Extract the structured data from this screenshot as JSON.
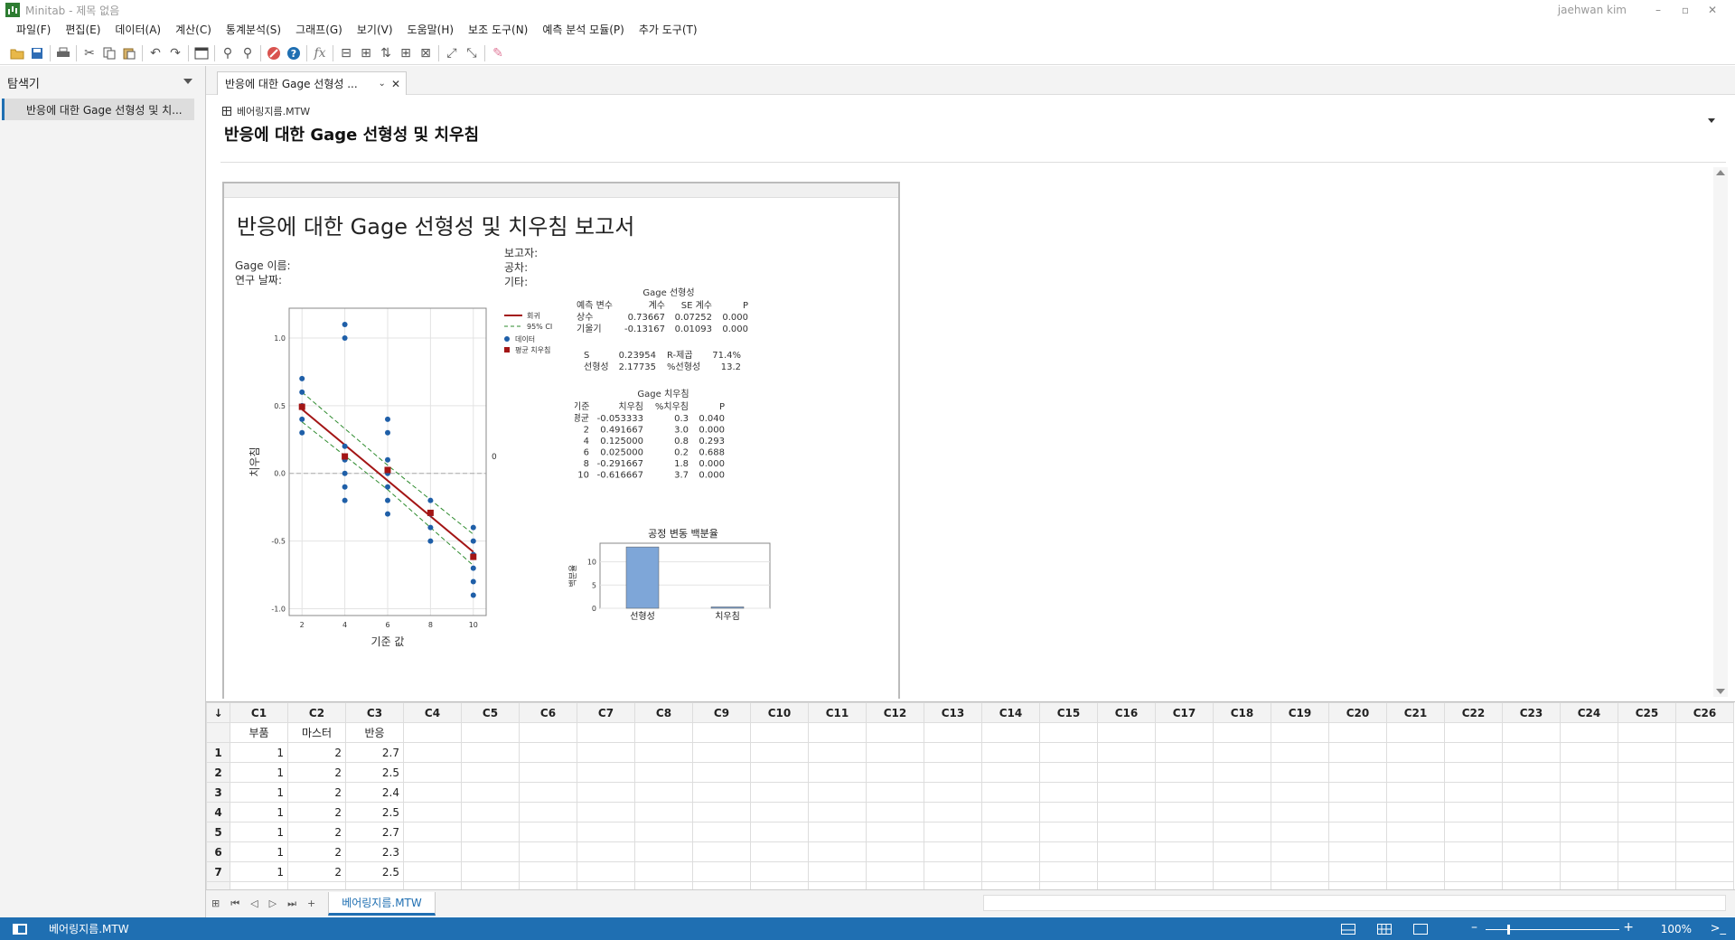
{
  "window": {
    "title": "Minitab - 제목 없음",
    "user": "jaehwan kim",
    "controls": [
      "–",
      "▫",
      "✕"
    ]
  },
  "menu": [
    "파일(F)",
    "편집(E)",
    "데이터(A)",
    "계산(C)",
    "통계분석(S)",
    "그래프(G)",
    "보기(V)",
    "도움말(H)",
    "보조 도구(N)",
    "예측 분석 모듈(P)",
    "추가 도구(T)"
  ],
  "navigator": {
    "header": "탐색기",
    "item": "반응에 대한 Gage 선형성 및 치..."
  },
  "tab": {
    "label": "반응에 대한 Gage 선형성 ...",
    "dropdown": "⌄",
    "close": "✕"
  },
  "output": {
    "worksheet": "베어링지름.MTW",
    "title": "반응에 대한 Gage 선형성 및 치우침"
  },
  "report": {
    "title": "반응에 대한 Gage 선형성 및 치우침 보고서",
    "gage_name": "Gage 이름:",
    "study_date": "연구 날짜:",
    "reporter": "보고자:",
    "tolerance": "공차:",
    "misc": "기타:"
  },
  "bias_plot": {
    "xlabel": "기준 값",
    "ylabel": "치우침",
    "x_ticks": [
      "2",
      "4",
      "6",
      "8",
      "10"
    ],
    "y_ticks": [
      "1.0",
      "0.5",
      "0.0",
      "-0.5",
      "-1.0"
    ],
    "xlim": [
      1.4,
      10.6
    ],
    "ylim": [
      -1.05,
      1.22
    ],
    "zero_label": "0",
    "legend": [
      "회귀",
      "95% CI",
      "데이터",
      "평균 치우침"
    ],
    "data_points": [
      {
        "x": 2,
        "y": 0.7
      },
      {
        "x": 2,
        "y": 0.6
      },
      {
        "x": 2,
        "y": 0.5
      },
      {
        "x": 2,
        "y": 0.4
      },
      {
        "x": 2,
        "y": 0.3
      },
      {
        "x": 4,
        "y": 1.1
      },
      {
        "x": 4,
        "y": 1.0
      },
      {
        "x": 4,
        "y": 0.2
      },
      {
        "x": 4,
        "y": 0.1
      },
      {
        "x": 4,
        "y": 0.0
      },
      {
        "x": 4,
        "y": -0.1
      },
      {
        "x": 4,
        "y": -0.2
      },
      {
        "x": 6,
        "y": 0.4
      },
      {
        "x": 6,
        "y": 0.3
      },
      {
        "x": 6,
        "y": 0.1
      },
      {
        "x": 6,
        "y": 0.0
      },
      {
        "x": 6,
        "y": -0.1
      },
      {
        "x": 6,
        "y": -0.2
      },
      {
        "x": 6,
        "y": -0.3
      },
      {
        "x": 8,
        "y": -0.2
      },
      {
        "x": 8,
        "y": -0.3
      },
      {
        "x": 8,
        "y": -0.4
      },
      {
        "x": 8,
        "y": -0.5
      },
      {
        "x": 10,
        "y": -0.4
      },
      {
        "x": 10,
        "y": -0.5
      },
      {
        "x": 10,
        "y": -0.6
      },
      {
        "x": 10,
        "y": -0.7
      },
      {
        "x": 10,
        "y": -0.8
      },
      {
        "x": 10,
        "y": -0.9
      }
    ],
    "avg_bias": [
      {
        "x": 2,
        "y": 0.491667
      },
      {
        "x": 4,
        "y": 0.125
      },
      {
        "x": 6,
        "y": 0.025
      },
      {
        "x": 8,
        "y": -0.291667
      },
      {
        "x": 10,
        "y": -0.616667
      }
    ],
    "regression": {
      "intercept": 0.73667,
      "slope": -0.13167
    },
    "ci_band": {
      "lower": [
        [
          2,
          0.38
        ],
        [
          6,
          -0.12
        ],
        [
          10,
          -0.68
        ]
      ],
      "upper": [
        [
          2,
          0.6
        ],
        [
          6,
          0.06
        ],
        [
          10,
          -0.45
        ]
      ]
    },
    "colors": {
      "regression": "#a31515",
      "ci": "#2e8b2e",
      "data": "#1f5fa8",
      "avg": "#a31515"
    }
  },
  "linearity_table": {
    "title": "Gage 선형성",
    "headers": [
      "예측 변수",
      "계수",
      "SE 계수",
      "P"
    ],
    "rows": [
      [
        "상수",
        "0.73667",
        "0.07252",
        "0.000"
      ],
      [
        "기울기",
        "-0.13167",
        "0.01093",
        "0.000"
      ]
    ],
    "stats": [
      [
        "S",
        "0.23954",
        "R-제곱",
        "71.4%"
      ],
      [
        "선형성",
        "2.17735",
        "%선형성",
        "13.2"
      ]
    ]
  },
  "bias_table": {
    "title": "Gage 치우침",
    "headers": [
      "기준",
      "치우침",
      "%치우침",
      "P"
    ],
    "rows": [
      [
        "평균",
        "-0.053333",
        "0.3",
        "0.040"
      ],
      [
        "2",
        "0.491667",
        "3.0",
        "0.000"
      ],
      [
        "4",
        "0.125000",
        "0.8",
        "0.293"
      ],
      [
        "6",
        "0.025000",
        "0.2",
        "0.688"
      ],
      [
        "8",
        "-0.291667",
        "1.8",
        "0.000"
      ],
      [
        "10",
        "-0.616667",
        "3.7",
        "0.000"
      ]
    ]
  },
  "chart_data": {
    "type": "bar",
    "title": "공정 변동 백분율",
    "ylabel": "백분율",
    "categories": [
      "선형성",
      "치우침"
    ],
    "values": [
      13.2,
      0.3
    ],
    "ylim": [
      0,
      14
    ],
    "y_ticks": [
      "0",
      "5",
      "10"
    ],
    "color": "#7ea6d8"
  },
  "worksheet": {
    "columns": [
      "C1",
      "C2",
      "C3",
      "C4",
      "C5",
      "C6",
      "C7",
      "C8",
      "C9",
      "C10",
      "C11",
      "C12",
      "C13",
      "C14",
      "C15",
      "C16",
      "C17",
      "C18",
      "C19",
      "C20",
      "C21",
      "C22",
      "C23",
      "C24",
      "C25",
      "C26"
    ],
    "names": [
      "부품",
      "마스터",
      "반응"
    ],
    "rows": [
      [
        "1",
        "2",
        "2.7"
      ],
      [
        "1",
        "2",
        "2.5"
      ],
      [
        "1",
        "2",
        "2.4"
      ],
      [
        "1",
        "2",
        "2.5"
      ],
      [
        "1",
        "2",
        "2.7"
      ],
      [
        "1",
        "2",
        "2.3"
      ],
      [
        "1",
        "2",
        "2.5"
      ]
    ],
    "corner": "↓"
  },
  "sheet_tab": "베어링지름.MTW",
  "status": {
    "file": "베어링지름.MTW",
    "zoom": "100%"
  }
}
